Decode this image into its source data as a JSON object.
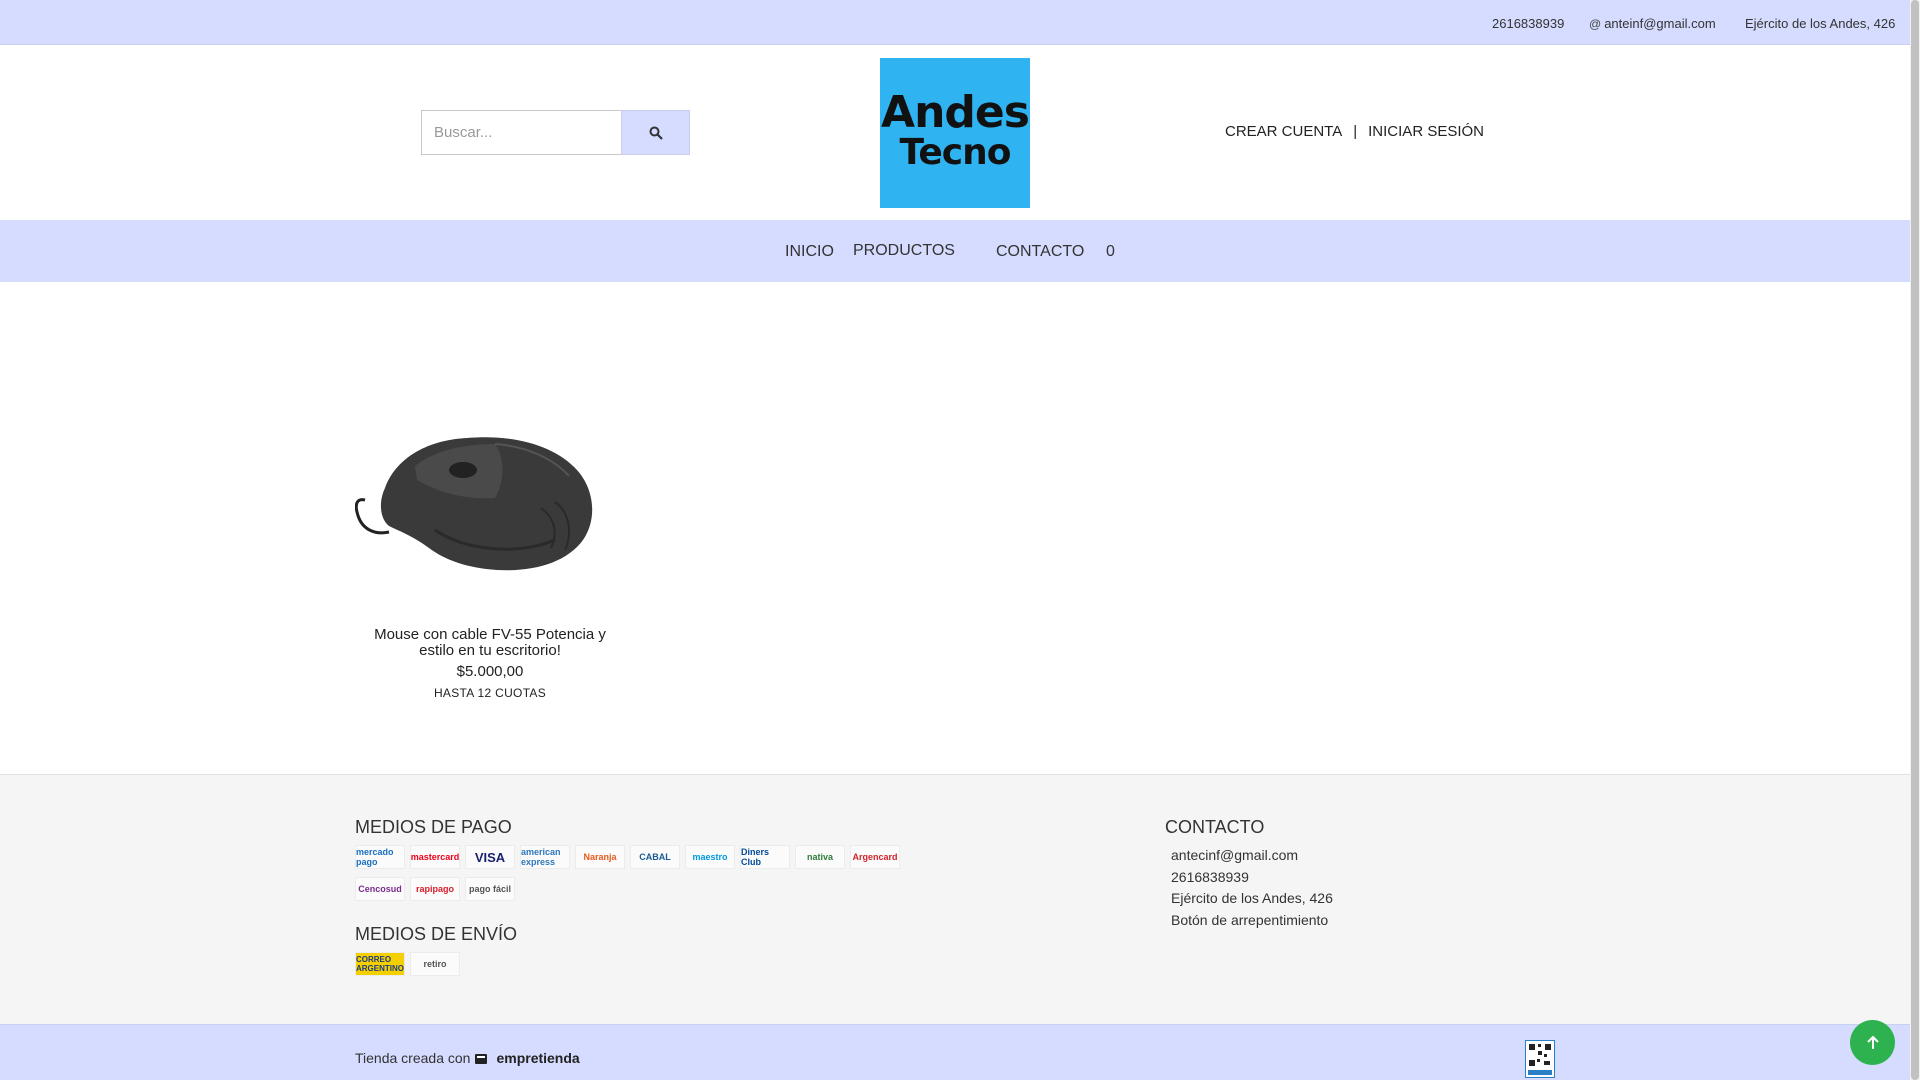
{
  "topbar": {
    "phone": "2616838939",
    "email": "anteinf@gmail.com",
    "address": "Ejército de los Andes, 426",
    "phone_icon": "",
    "email_icon": "@",
    "address_icon": ""
  },
  "search": {
    "placeholder": "Buscar..."
  },
  "logo": {
    "line1": "Andes",
    "line2": "Tecno"
  },
  "account": {
    "create": "CREAR CUENTA",
    "separator": "|",
    "login": "INICIAR SESIÓN"
  },
  "nav": {
    "inicio": "INICIO",
    "productos": "PRODUCTOS",
    "productos_caret": "",
    "contacto": "CONTACTO",
    "cart_icon": "",
    "cart_count": "0"
  },
  "product": {
    "title": "Mouse con cable FV-55 Potencia y estilo en tu escritorio!",
    "price": "$5.000,00",
    "installments": "HASTA 12 CUOTAS"
  },
  "footer": {
    "payments_title": "MEDIOS DE PAGO",
    "payments": [
      "mercado pago",
      "mastercard",
      "VISA",
      "american express",
      "Naranja",
      "CABAL",
      "maestro",
      "Diners Club",
      "nativa",
      "Argencard",
      "Cencosud",
      "rapipago",
      "pago fácil"
    ],
    "shipping_title": "MEDIOS DE ENVÍO",
    "shipping": [
      "CORREO ARGENTINO",
      "retiro"
    ],
    "contact_title": "CONTACTO",
    "contact_email": "antecinf@gmail.com",
    "contact_phone": "2616838939",
    "contact_address": "Ejército de los Andes, 426",
    "contact_repent": "Botón de arrepentimiento",
    "contact_icon": ""
  },
  "bottom": {
    "credit": "Tienda creada con",
    "brand": "empretienda"
  },
  "colors": {
    "bar": "#d5dcff",
    "logo_bg": "#2fb4f1",
    "top_button": "#2eb24f"
  }
}
